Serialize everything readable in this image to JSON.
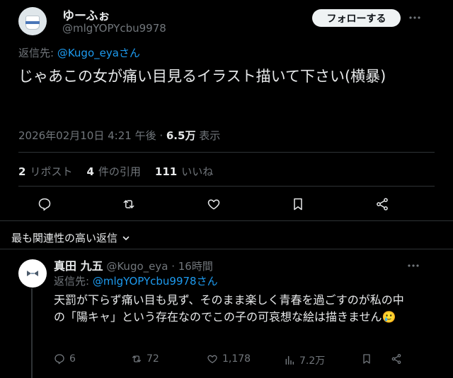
{
  "tweet": {
    "display_name": "ゆーふぉ",
    "handle": "@mlgYOPYcbu9978",
    "follow_label": "フォローする",
    "reply_to_label": "返信先: ",
    "reply_to_handle": "@Kugo_eyaさん",
    "text": "じゃあこの女が痛い目見るイラスト描いて下さい(横暴)",
    "timestamp": "2026年02月10日 4:21 午後 · ",
    "views_count": "6.5万",
    "views_label": " 表示",
    "reposts_count": "2",
    "reposts_label": "リポスト",
    "quotes_count": "4",
    "quotes_label": "件の引用",
    "likes_count": "111",
    "likes_label": "いいね"
  },
  "relevant_replies_label": "最も関連性の高い返信",
  "reply": {
    "display_name": "真田 九五",
    "handle_time": " @Kugo_eya · 16時間",
    "reply_to_label": "返信先: ",
    "reply_to_handle": "@mlgYOPYcbu9978さん",
    "text": "天罰が下らず痛い目も見ず、そのまま楽しく青春を過ごすのが私の中の「陽キャ」という存在なのでこの子の可哀想な絵は描きません🥲",
    "replies": "6",
    "reposts": "72",
    "likes": "1,178",
    "views": "7.2万"
  },
  "colors": {
    "background": "#000000",
    "text": "#e7e9ea",
    "muted": "#71767b",
    "link": "#1d9bf0",
    "divider": "#2f3336"
  },
  "icons": [
    "more-icon",
    "reply-icon",
    "repost-icon",
    "like-icon",
    "bookmark-icon",
    "share-icon",
    "chevron-down-icon",
    "views-icon"
  ]
}
